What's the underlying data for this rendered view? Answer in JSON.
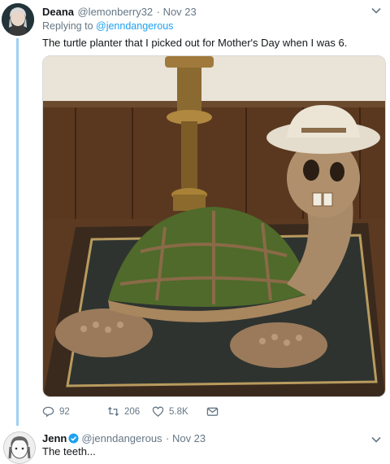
{
  "tweet1": {
    "display_name": "Deana",
    "handle": "@lemonberry32",
    "date": "· Nov 23",
    "replying_prefix": "Replying to ",
    "replying_to": "@jenndangerous",
    "text": "The turtle planter that I picked out for Mother's Day when I was 6.",
    "photo_icon": "turtle-planter-photo",
    "actions": {
      "replies": "92",
      "retweets": "206",
      "likes": "5.8K"
    }
  },
  "tweet2": {
    "display_name": "Jenn",
    "handle": "@jenndangerous",
    "date": "· Nov 23",
    "text": "The teeth..."
  },
  "colors": {
    "accent": "#1da1f2",
    "thread_line": "#9fd0f5",
    "muted": "#657786"
  }
}
